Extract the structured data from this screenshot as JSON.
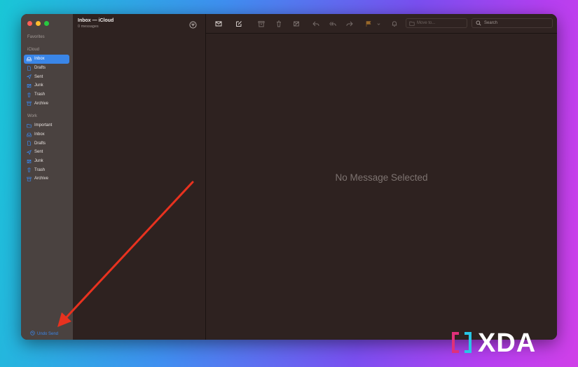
{
  "window": {
    "traffic_lights": [
      "close",
      "minimize",
      "zoom"
    ]
  },
  "sidebar": {
    "favorites_title": "Favorites",
    "icloud_title": "iCloud",
    "icloud_items": [
      {
        "label": "Inbox",
        "icon": "inbox-icon",
        "selected": true
      },
      {
        "label": "Drafts",
        "icon": "document-icon"
      },
      {
        "label": "Sent",
        "icon": "paperplane-icon"
      },
      {
        "label": "Junk",
        "icon": "junk-icon"
      },
      {
        "label": "Trash",
        "icon": "trash-icon"
      },
      {
        "label": "Archive",
        "icon": "archive-icon"
      }
    ],
    "work_title": "Work",
    "work_items": [
      {
        "label": "Important",
        "icon": "folder-icon"
      },
      {
        "label": "Inbox",
        "icon": "inbox-icon"
      },
      {
        "label": "Drafts",
        "icon": "document-icon"
      },
      {
        "label": "Sent",
        "icon": "paperplane-icon"
      },
      {
        "label": "Junk",
        "icon": "junk-icon"
      },
      {
        "label": "Trash",
        "icon": "trash-icon"
      },
      {
        "label": "Archive",
        "icon": "archive-icon"
      }
    ],
    "undo_send": "Undo Send"
  },
  "message_list": {
    "title": "Inbox — iCloud",
    "subtitle": "0 messages"
  },
  "toolbar": {
    "move_to_placeholder": "Move to...",
    "search_placeholder": "Search"
  },
  "content": {
    "empty_message": "No Message Selected"
  },
  "watermark": {
    "brand": "XDA"
  },
  "colors": {
    "accent": "#3a86e8",
    "annotation_arrow": "#e8321f",
    "window_bg": "#2e2220",
    "sidebar_bg": "#4a4240"
  }
}
